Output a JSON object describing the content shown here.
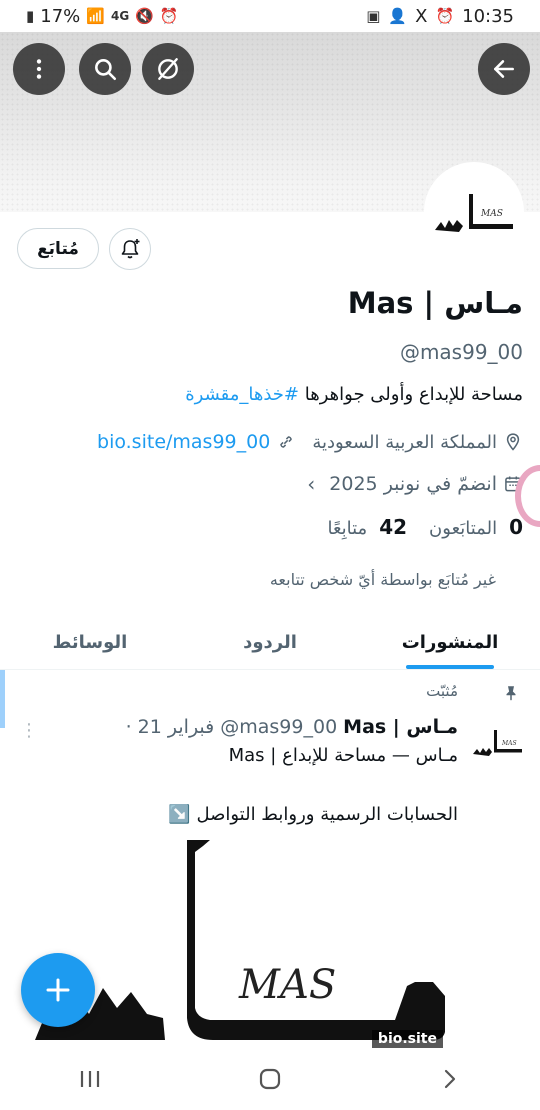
{
  "status_bar": {
    "battery": "17%",
    "network": "4G",
    "time": "10:35",
    "x_label": "X"
  },
  "profile": {
    "display_name": "Mas | مـاس",
    "handle": "@mas99_00",
    "bio_text": "مساحة للإبداع وأولى جواهرها ",
    "bio_hashtag": "#خذها_مقشرة",
    "location": "المملكة العربية السعودية",
    "link": "bio.site/mas99_00",
    "joined": "انضمّ في نونبر 2025",
    "followers_count": "0",
    "followers_label": "المتابَعون",
    "following_count": "42",
    "following_label": "متابِعًا",
    "not_followed_note": "غير مُتابَع بواسطة أيّ شخص تتابعه",
    "follow_button": "مُتابَع",
    "avatar_text": "مــاس"
  },
  "tabs": [
    {
      "label": "المنشورات",
      "active": true
    },
    {
      "label": "الردود",
      "active": false
    },
    {
      "label": "الوسائط",
      "active": false
    }
  ],
  "post": {
    "pinned_label": "مُثبّت",
    "author_name": "Mas | مـاس",
    "author_handle": "@mas99_00",
    "date": "· 21 فبراير",
    "subtitle": "Mas | مـاس — مساحة للإبداع",
    "text": "الحسابات الرسمية وروابط التواصل ↘️",
    "media_signature": "MAS",
    "media_badge": "bio.site"
  },
  "colors": {
    "accent": "#1d9bf0",
    "secondary_text": "#536471",
    "primary_text": "#0f1419"
  }
}
